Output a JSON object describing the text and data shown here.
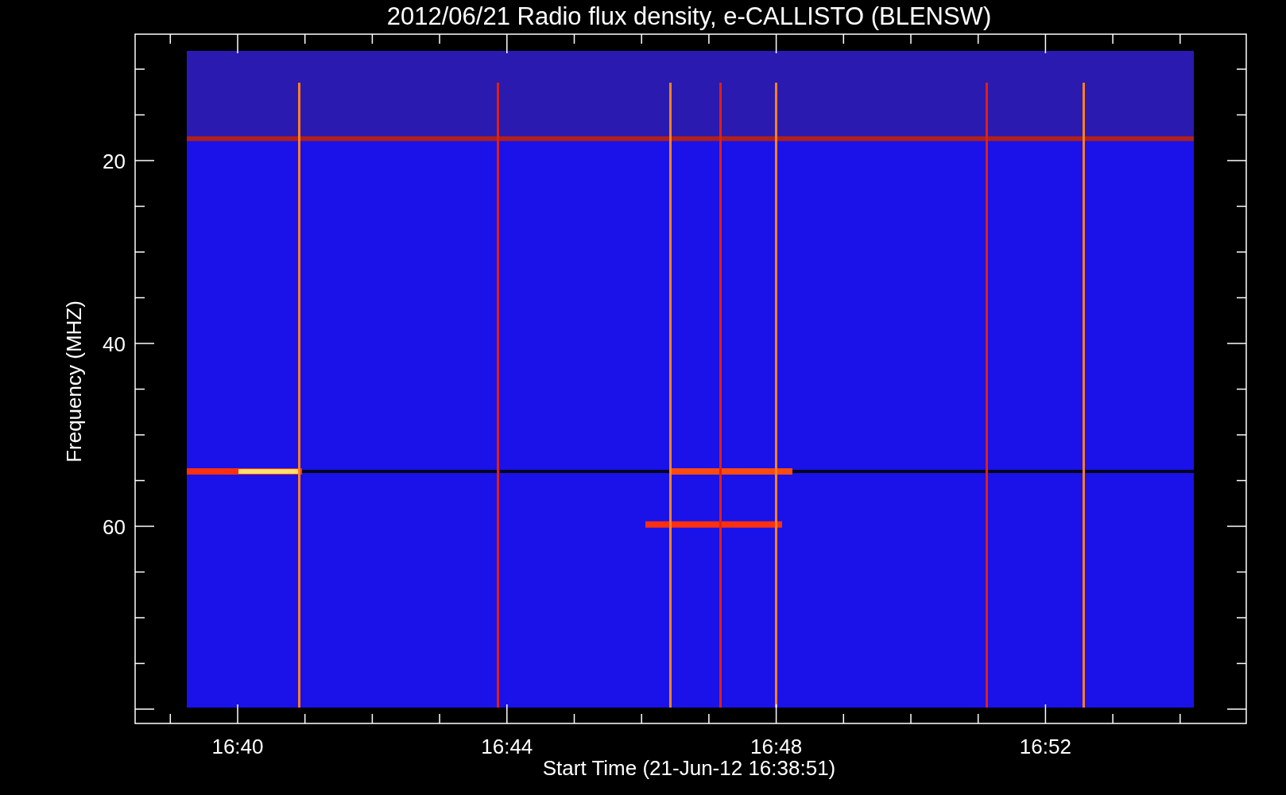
{
  "title": "2012/06/21  Radio flux density, e-CALLISTO (BLENSW)",
  "y_axis": {
    "title": "Frequency (MHZ)",
    "tick_labels": [
      "20",
      "40",
      "60"
    ]
  },
  "x_axis": {
    "title": "Start Time (21-Jun-12 16:38:51)",
    "tick_labels": [
      "16:40",
      "16:44",
      "16:48",
      "16:52"
    ]
  }
}
